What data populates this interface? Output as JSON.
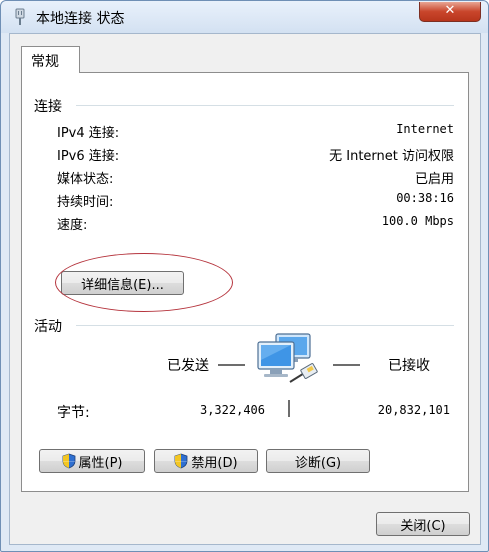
{
  "window": {
    "title": "本地连接 状态",
    "close_symbol": "✕"
  },
  "tabs": [
    {
      "label": "常规"
    }
  ],
  "connection": {
    "heading": "连接",
    "rows": [
      {
        "label": "IPv4 连接:",
        "value": "Internet"
      },
      {
        "label": "IPv6 连接:",
        "value": "无 Internet 访问权限"
      },
      {
        "label": "媒体状态:",
        "value": "已启用"
      },
      {
        "label": "持续时间:",
        "value": "00:38:16"
      },
      {
        "label": "速度:",
        "value": "100.0 Mbps"
      }
    ],
    "details_button": "详细信息(E)..."
  },
  "activity": {
    "heading": "活动",
    "sent_label": "已发送",
    "received_label": "已接收",
    "bytes_label": "字节:",
    "bytes_sent": "3,322,406",
    "bytes_received": "20,832,101"
  },
  "buttons": {
    "properties": "属性(P)",
    "disable": "禁用(D)",
    "diagnose": "诊断(G)",
    "close": "关闭(C)"
  },
  "icons": {
    "title": "network-adapter-icon",
    "activity": "network-computers-icon",
    "uac": "uac-shield-icon"
  },
  "colors": {
    "annotation": "#b5343d",
    "close_button": "#c9462c"
  }
}
